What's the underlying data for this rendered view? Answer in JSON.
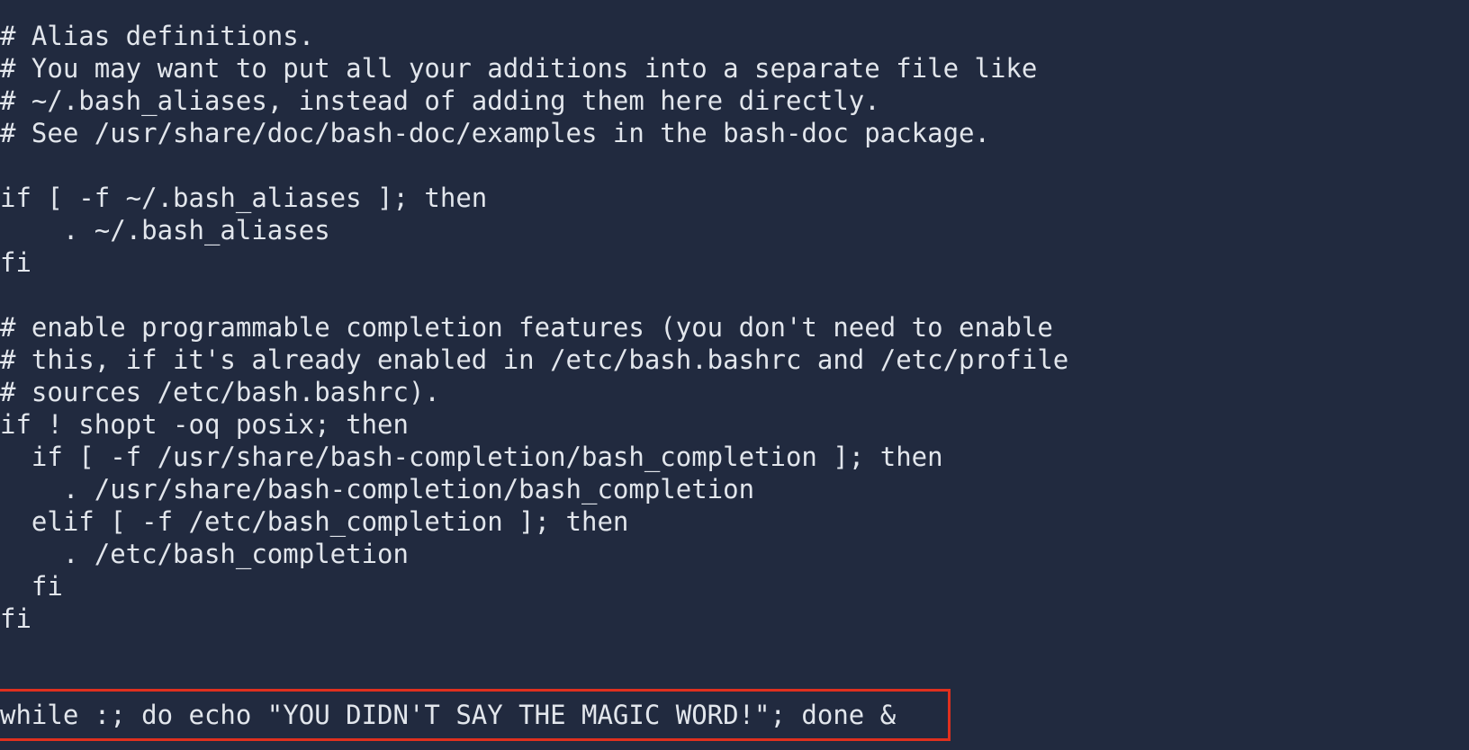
{
  "terminal": {
    "lines": [
      "# Alias definitions.",
      "# You may want to put all your additions into a separate file like",
      "# ~/.bash_aliases, instead of adding them here directly.",
      "# See /usr/share/doc/bash-doc/examples in the bash-doc package.",
      "",
      "if [ -f ~/.bash_aliases ]; then",
      "    . ~/.bash_aliases",
      "fi",
      "",
      "# enable programmable completion features (you don't need to enable",
      "# this, if it's already enabled in /etc/bash.bashrc and /etc/profile",
      "# sources /etc/bash.bashrc).",
      "if ! shopt -oq posix; then",
      "  if [ -f /usr/share/bash-completion/bash_completion ]; then",
      "    . /usr/share/bash-completion/bash_completion",
      "  elif [ -f /etc/bash_completion ]; then",
      "    . /etc/bash_completion",
      "  fi",
      "fi"
    ],
    "highlighted_line": "while :; do echo \"YOU DIDN'T SAY THE MAGIC WORD!\"; done &",
    "colors": {
      "background": "#212a3f",
      "text": "#e2e6ec",
      "highlight_border": "#e0301e"
    }
  }
}
